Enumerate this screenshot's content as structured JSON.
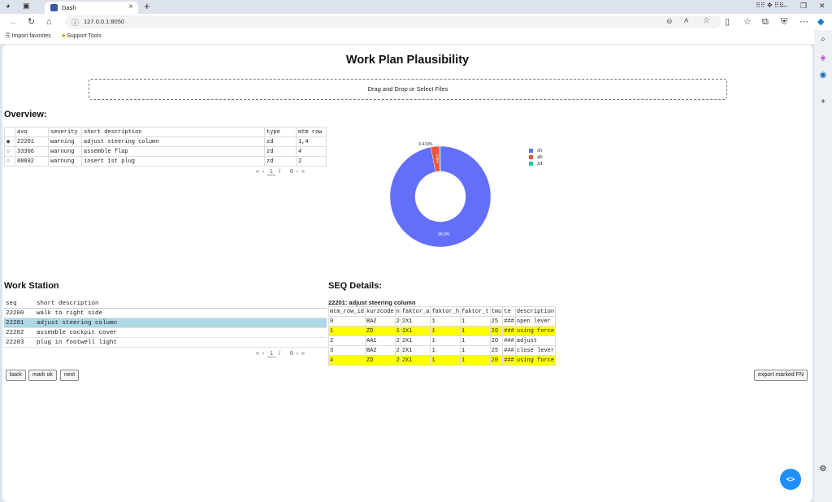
{
  "browser": {
    "tab_title": "Dash",
    "url": "127.0.0.1:8050",
    "favorites": [
      "Import favorites",
      "Support Tools"
    ]
  },
  "page": {
    "title": "Work Plan Plausibility",
    "upload_text": "Drag and Drop or Select Files"
  },
  "overview": {
    "heading": "Overview:",
    "columns": [
      "avo",
      "severity",
      "short description",
      "type",
      "mtm row"
    ],
    "rows": [
      {
        "avo": "22201",
        "severity": "warning",
        "desc": "adjust steering column",
        "type": "zd",
        "mtm": "1,4",
        "selected": true
      },
      {
        "avo": "33306",
        "severity": "warnung",
        "desc": "assemble flap",
        "type": "zd",
        "mtm": "4",
        "selected": false
      },
      {
        "avo": "88802",
        "severity": "warnung",
        "desc": "insert 1st plug",
        "type": "zd",
        "mtm": "2",
        "selected": false
      }
    ],
    "pager": {
      "page": "1",
      "sep": "/",
      "total": "6"
    }
  },
  "chart_data": {
    "type": "pie",
    "hole": true,
    "labels": [
      "sh",
      "ab",
      "zd"
    ],
    "values": [
      96.9,
      2.681,
      0.419
    ],
    "colors": [
      "#636efa",
      "#ef553b",
      "#00cc96"
    ],
    "slice_labels": [
      "96.9%",
      "2.68%",
      "0.419%"
    ],
    "legend": "top-right"
  },
  "workstation": {
    "heading": "Work Station",
    "columns": [
      "seq",
      "short description"
    ],
    "rows": [
      {
        "seq": "22200",
        "desc": "walk to right side",
        "selected": false
      },
      {
        "seq": "22201",
        "desc": "adjust steering column",
        "selected": true
      },
      {
        "seq": "22202",
        "desc": "assemble cockpit cover",
        "selected": false
      },
      {
        "seq": "22203",
        "desc": "plug in footwell light",
        "selected": false
      }
    ],
    "pager": {
      "page": "1",
      "sep": "/",
      "total": "6"
    }
  },
  "seq": {
    "heading": "SEQ Details:",
    "subtitle": "22201: adjust steering column",
    "columns": [
      "mtm_row_id",
      "kurzcode",
      "n",
      "faktor_a",
      "faktor_h",
      "faktor_t",
      "tmu",
      "te",
      "description"
    ],
    "rows": [
      {
        "cells": [
          "0",
          "BA2",
          "2",
          "2X1",
          "1",
          "1",
          "25",
          "###",
          "open lever"
        ],
        "hl": false
      },
      {
        "cells": [
          "1",
          "ZD",
          "1",
          "1X1",
          "1",
          "1",
          "20",
          "###",
          "using force"
        ],
        "hl": true
      },
      {
        "cells": [
          "2",
          "AA1",
          "2",
          "2X1",
          "1",
          "1",
          "20",
          "###",
          "adjust"
        ],
        "hl": false
      },
      {
        "cells": [
          "3",
          "BA2",
          "2",
          "2X1",
          "1",
          "1",
          "25",
          "###",
          "close lever"
        ],
        "hl": false
      },
      {
        "cells": [
          "4",
          "ZD",
          "2",
          "2X1",
          "1",
          "1",
          "20",
          "###",
          "using force"
        ],
        "hl": true
      }
    ]
  },
  "buttons": {
    "back": "back",
    "mark_ok": "mark ok",
    "next": "next",
    "export": "export marked FN"
  },
  "pager_icons": {
    "first": "«",
    "prev": "‹",
    "next": "›",
    "last": "»"
  }
}
